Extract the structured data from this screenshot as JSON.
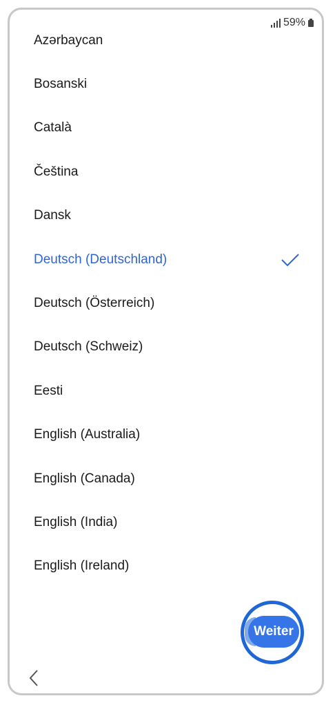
{
  "status": {
    "battery": "59%"
  },
  "languages": [
    {
      "label": "Azərbaycan"
    },
    {
      "label": "Bosanski"
    },
    {
      "label": "Català"
    },
    {
      "label": "Čeština"
    },
    {
      "label": "Dansk"
    },
    {
      "label": "Deutsch (Deutschland)",
      "selected": true
    },
    {
      "label": "Deutsch (Österreich)"
    },
    {
      "label": "Deutsch (Schweiz)"
    },
    {
      "label": "Eesti"
    },
    {
      "label": "English (Australia)"
    },
    {
      "label": "English (Canada)"
    },
    {
      "label": "English (India)"
    },
    {
      "label": "English (Ireland)"
    }
  ],
  "next_button": {
    "label": "Weiter"
  },
  "colors": {
    "accent": "#2e64d9",
    "button": "#3575e8",
    "highlight_ring": "#1f66d6"
  },
  "icons": [
    "signal-icon",
    "battery-icon",
    "check-icon",
    "back-chevron-icon"
  ]
}
